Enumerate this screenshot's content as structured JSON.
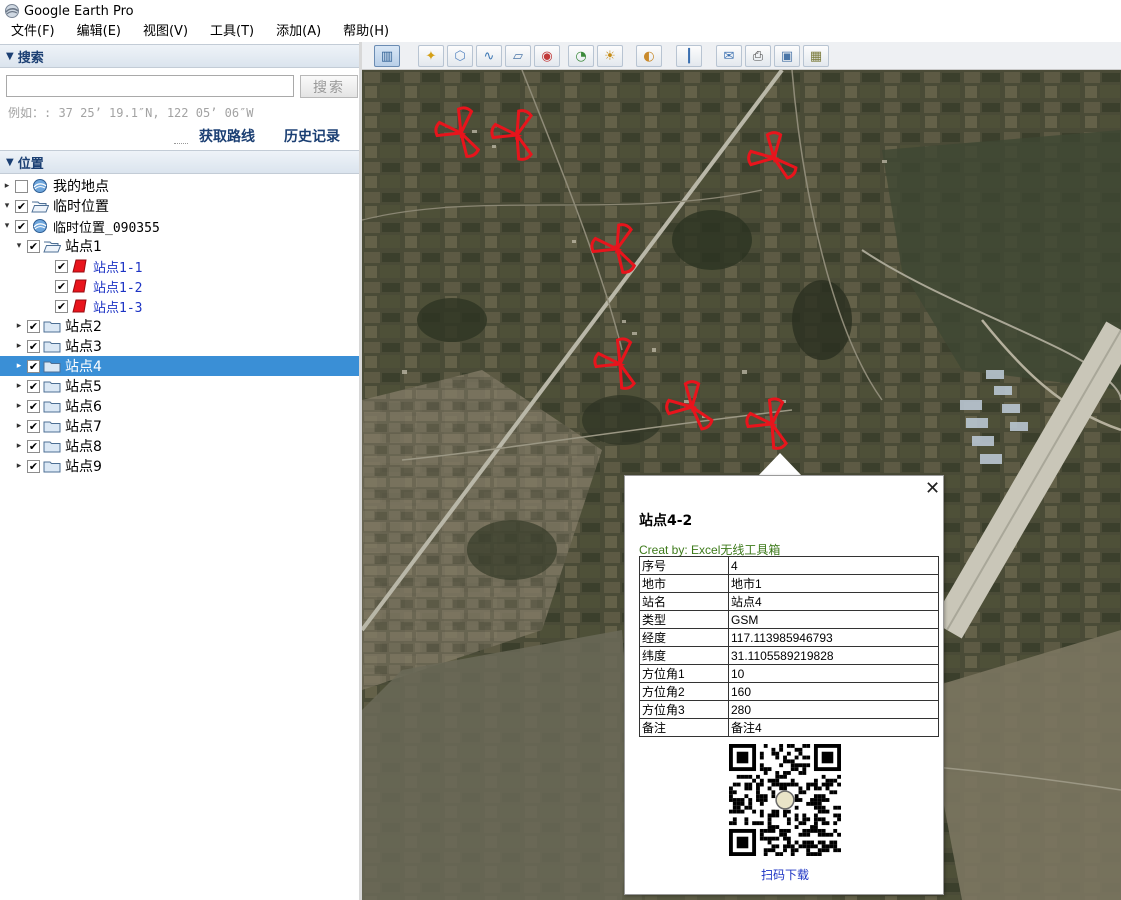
{
  "window": {
    "title": "Google Earth Pro"
  },
  "menu": [
    "文件(F)",
    "编辑(E)",
    "视图(V)",
    "工具(T)",
    "添加(A)",
    "帮助(H)"
  ],
  "search": {
    "header": "搜索",
    "value": "",
    "button": "搜索",
    "hint": "例如：: 37 25’ 19.1″N, 122 05’ 06″W",
    "get_directions": "获取路线",
    "history": "历史记录"
  },
  "places": {
    "header": "位置",
    "items": [
      {
        "label": "我的地点",
        "indent": 0,
        "expand": "▸",
        "checked": false,
        "icon": "globe-icon"
      },
      {
        "label": "临时位置",
        "indent": 0,
        "expand": "▾",
        "checked": true,
        "icon": "folder-open-icon"
      },
      {
        "label": "临时位置_090355",
        "indent": 1,
        "expand": "▾",
        "checked": true,
        "icon": "globe-icon"
      },
      {
        "label": "站点1",
        "indent": 2,
        "expand": "▾",
        "checked": true,
        "icon": "folder-open-icon"
      },
      {
        "label": "站点1-1",
        "indent": 3,
        "expand": "",
        "checked": true,
        "icon": "sector-polygon-icon"
      },
      {
        "label": "站点1-2",
        "indent": 3,
        "expand": "",
        "checked": true,
        "icon": "sector-polygon-icon"
      },
      {
        "label": "站点1-3",
        "indent": 3,
        "expand": "",
        "checked": true,
        "icon": "sector-polygon-icon"
      },
      {
        "label": "站点2",
        "indent": 2,
        "expand": "▸",
        "checked": true,
        "icon": "folder-icon"
      },
      {
        "label": "站点3",
        "indent": 2,
        "expand": "▸",
        "checked": true,
        "icon": "folder-icon"
      },
      {
        "label": "站点4",
        "indent": 2,
        "expand": "▸",
        "checked": true,
        "icon": "folder-icon",
        "selected": true
      },
      {
        "label": "站点5",
        "indent": 2,
        "expand": "▸",
        "checked": true,
        "icon": "folder-icon"
      },
      {
        "label": "站点6",
        "indent": 2,
        "expand": "▸",
        "checked": true,
        "icon": "folder-icon"
      },
      {
        "label": "站点7",
        "indent": 2,
        "expand": "▸",
        "checked": true,
        "icon": "folder-icon"
      },
      {
        "label": "站点8",
        "indent": 2,
        "expand": "▸",
        "checked": true,
        "icon": "folder-icon"
      },
      {
        "label": "站点9",
        "indent": 2,
        "expand": "▸",
        "checked": true,
        "icon": "folder-icon"
      }
    ]
  },
  "toolbar": {
    "buttons": [
      "sidebar-toggle-icon",
      "placemark-icon",
      "polygon-icon",
      "path-icon",
      "overlay-icon",
      "tour-record-icon",
      "historical-imagery-icon",
      "sunlight-icon",
      "planets-icon",
      "ruler-icon",
      "email-icon",
      "print-icon",
      "save-image-icon",
      "map-view-icon"
    ]
  },
  "balloon": {
    "title": "站点4-2",
    "credit": "Creat by: Excel无线工具箱",
    "rows": [
      {
        "key": "序号",
        "value": "4"
      },
      {
        "key": "地市",
        "value": "地市1"
      },
      {
        "key": "站名",
        "value": "站点4"
      },
      {
        "key": "类型",
        "value": "GSM"
      },
      {
        "key": "经度",
        "value": "117.113985946793"
      },
      {
        "key": "纬度",
        "value": "31.1105589219828"
      },
      {
        "key": "方位角1",
        "value": "10"
      },
      {
        "key": "方位角2",
        "value": "160"
      },
      {
        "key": "方位角3",
        "value": "280"
      },
      {
        "key": "备注",
        "value": "备注4"
      }
    ],
    "qr_caption": "扫码下载",
    "close": "✕"
  },
  "colors": {
    "accent": "#3a8fd6",
    "sector": "#e8141c",
    "header_text": "#1b3f73",
    "link_blue": "#1c33c4"
  }
}
